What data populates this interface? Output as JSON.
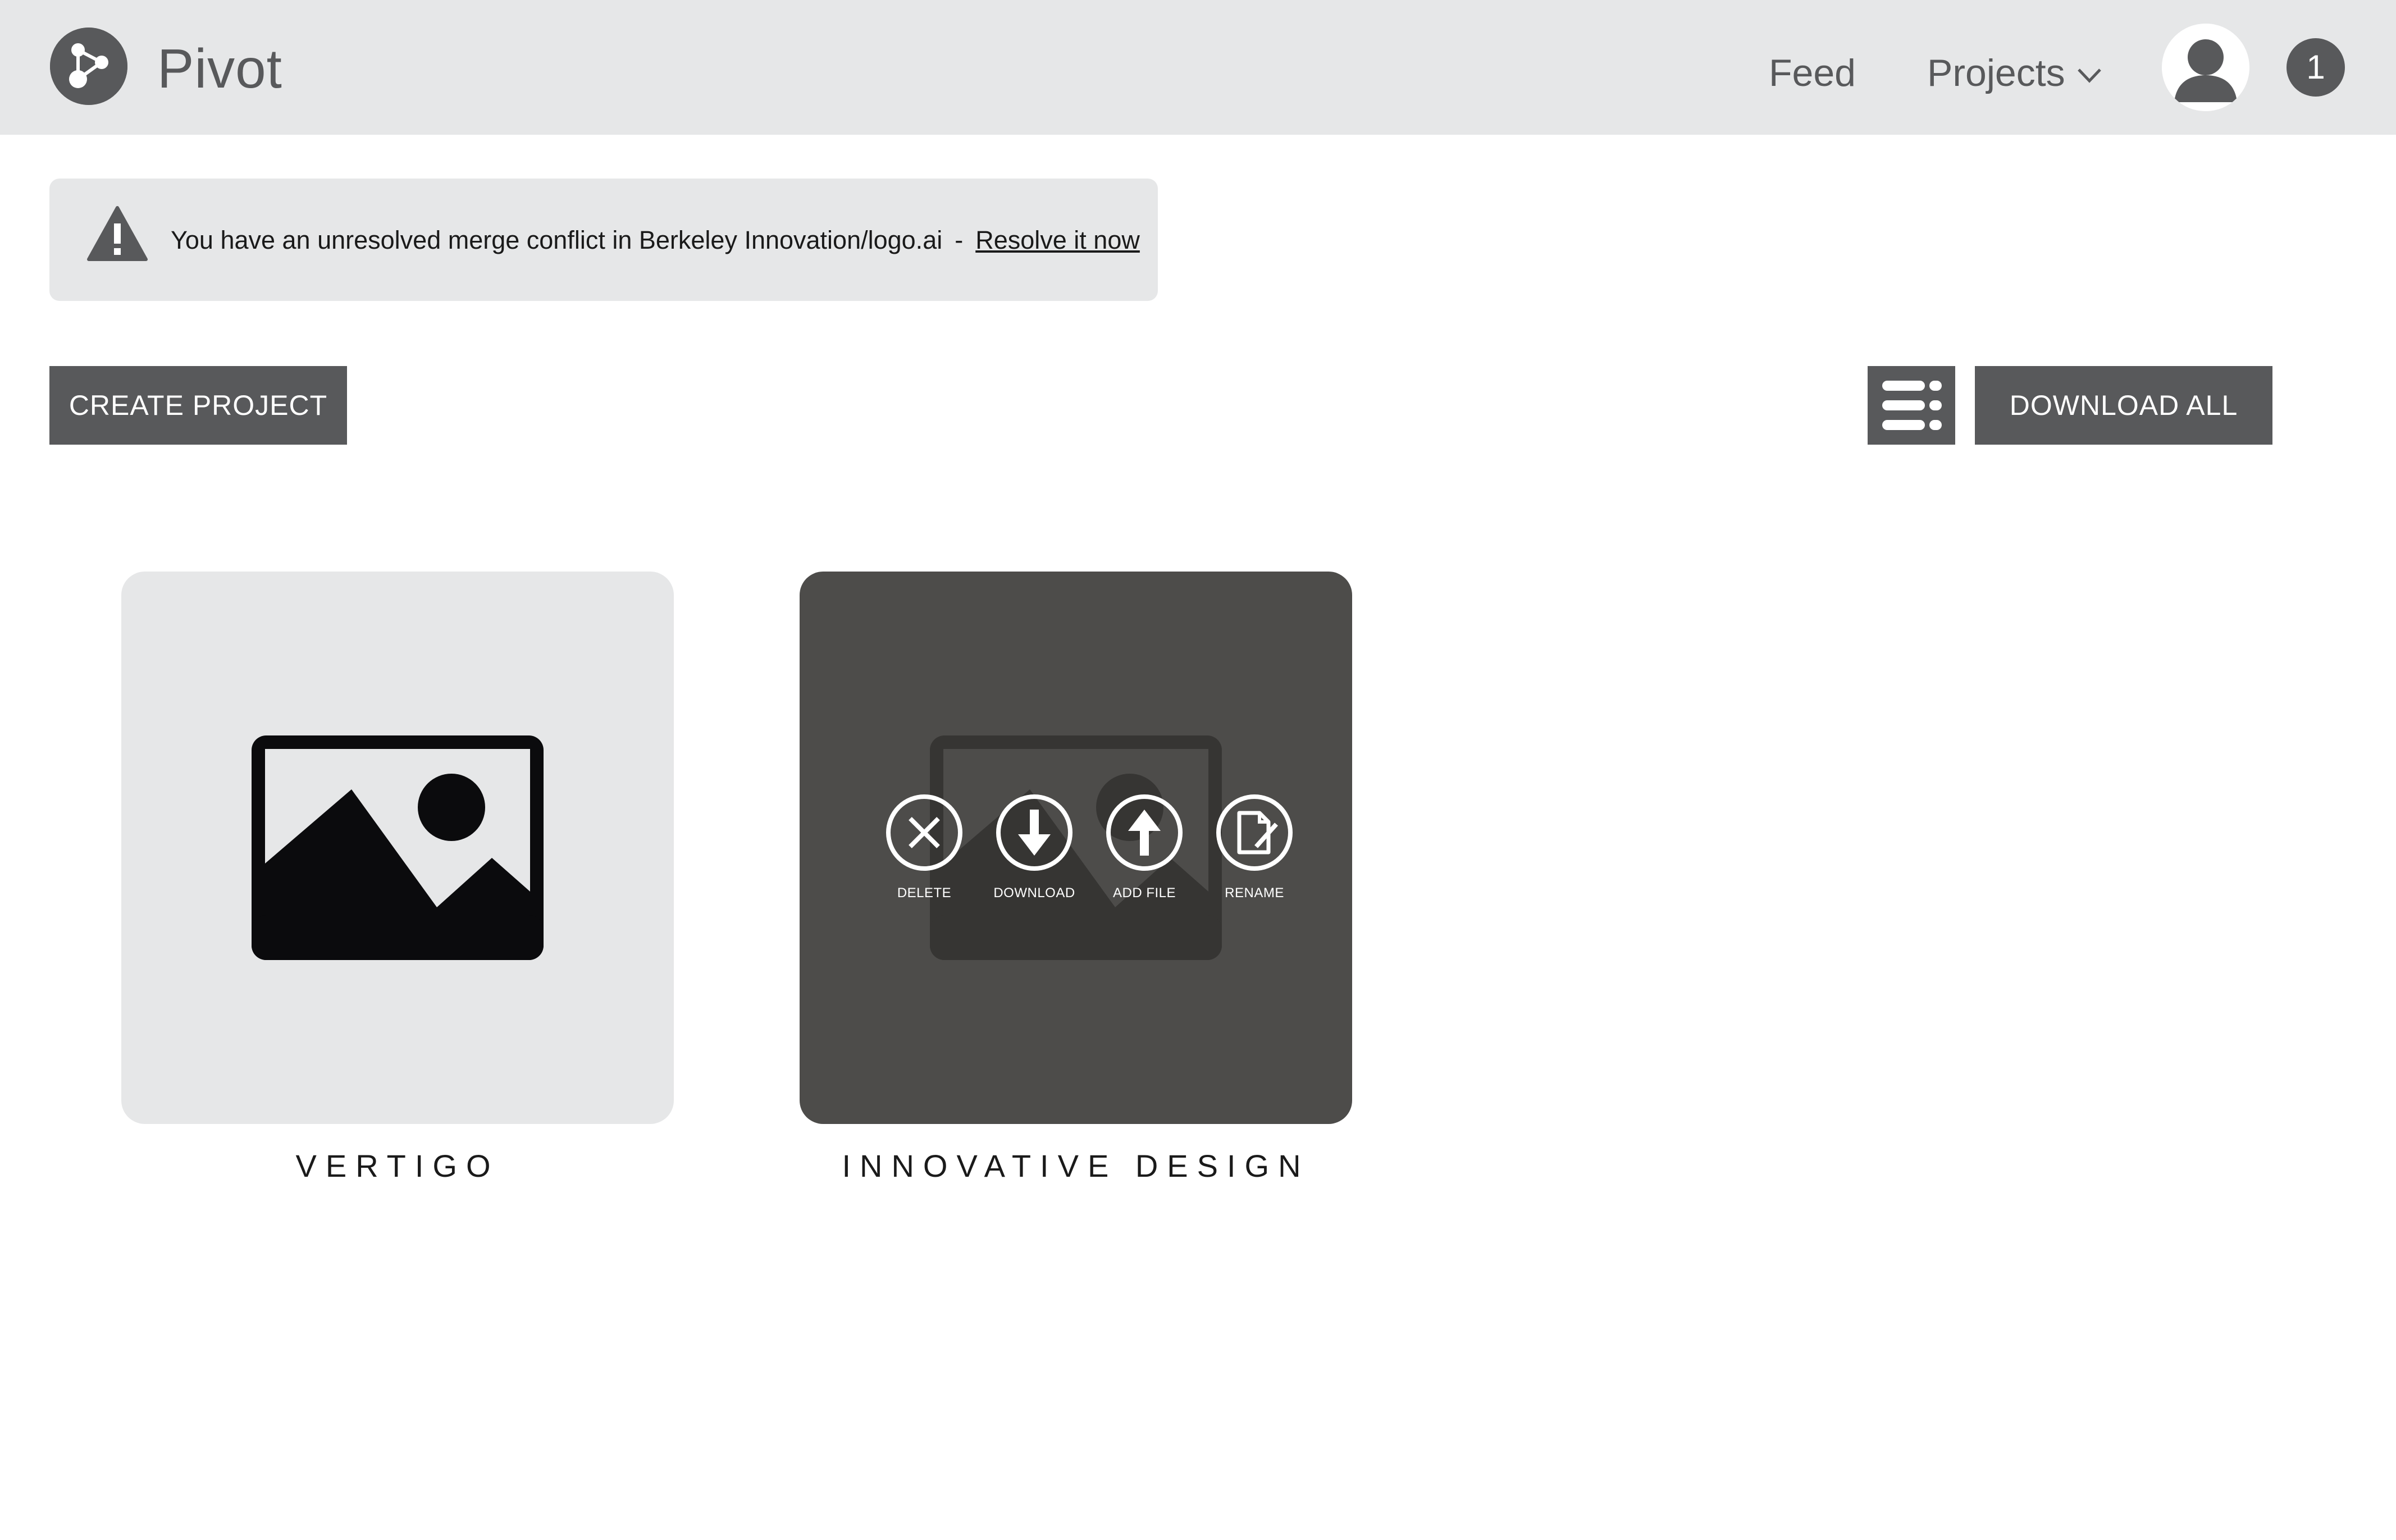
{
  "app": {
    "name": "Pivot",
    "logo_icon": "share-icon"
  },
  "nav": {
    "feed_label": "Feed",
    "projects_label": "Projects",
    "projects_icon": "chevron-down-icon",
    "avatar_icon": "user-icon",
    "notification_count": "1"
  },
  "alert": {
    "icon": "warning-icon",
    "message": "You have an unresolved merge conflict in Berkeley Innovation/logo.ai",
    "separator": "-",
    "link_label": "Resolve it now"
  },
  "toolbar": {
    "create_label": "CREATE PROJECT",
    "view_icon": "list-view-icon",
    "download_all_label": "DOWNLOAD ALL"
  },
  "projects": [
    {
      "title": "VERTIGO",
      "thumbnail_icon": "image-icon",
      "state": "default"
    },
    {
      "title": "INNOVATIVE DESIGN",
      "thumbnail_icon": "image-icon",
      "state": "hover",
      "actions": [
        {
          "label": "DELETE",
          "icon": "close-circle-icon"
        },
        {
          "label": "DOWNLOAD",
          "icon": "download-circle-icon"
        },
        {
          "label": "ADD FILE",
          "icon": "upload-circle-icon"
        },
        {
          "label": "RENAME",
          "icon": "edit-document-icon"
        }
      ]
    }
  ],
  "colors": {
    "topbar_bg": "#e6e7e8",
    "primary_dark": "#58595b",
    "card_hover_bg": "#4d4c4a",
    "text": "#1a1a1a"
  }
}
